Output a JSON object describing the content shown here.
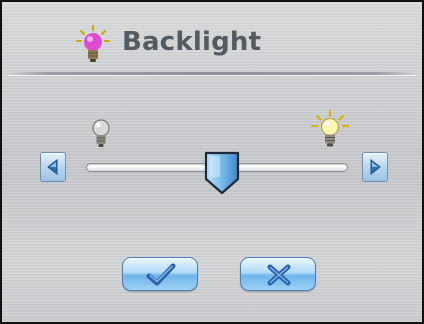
{
  "dialog": {
    "title": "Backlight",
    "icons": {
      "title": "lightbulb-icon",
      "min": "dim-bulb-icon",
      "max": "bright-bulb-icon"
    }
  },
  "slider": {
    "level": 0.52,
    "decrease_icon": "arrow-left-icon",
    "increase_icon": "arrow-right-icon"
  },
  "actions": {
    "ok_icon": "checkmark-icon",
    "cancel_icon": "cross-icon"
  },
  "colors": {
    "title_text": "#555a60",
    "button_blue": "#6fb4e9",
    "bulb_glow": "#e04ad0"
  }
}
